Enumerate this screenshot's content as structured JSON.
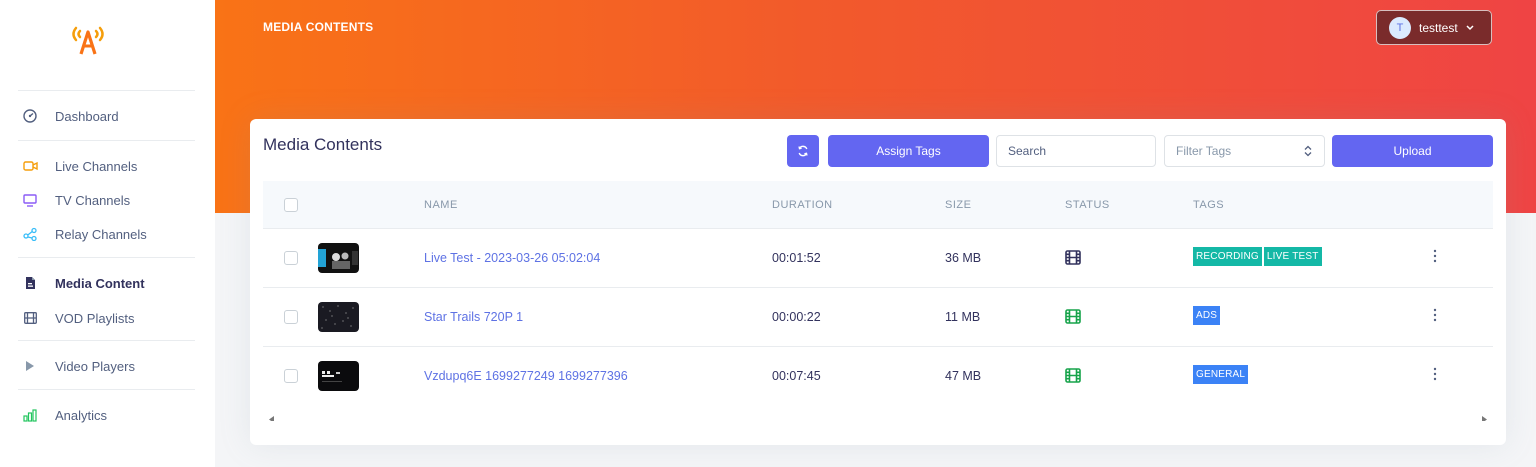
{
  "sidebar": {
    "items": [
      {
        "label": "Dashboard",
        "icon": "gauge-icon"
      },
      {
        "label": "Live Channels",
        "icon": "video-camera-icon"
      },
      {
        "label": "TV Channels",
        "icon": "tv-icon"
      },
      {
        "label": "Relay Channels",
        "icon": "share-nodes-icon"
      },
      {
        "label": "Media Content",
        "icon": "file-icon"
      },
      {
        "label": "VOD Playlists",
        "icon": "film-icon"
      },
      {
        "label": "Video Players",
        "icon": "play-icon"
      },
      {
        "label": "Analytics",
        "icon": "bar-chart-icon"
      }
    ],
    "active": "Media Content"
  },
  "header": {
    "title": "MEDIA CONTENTS",
    "user": {
      "initial": "T",
      "name": "testtest"
    }
  },
  "card": {
    "title": "Media Contents",
    "assign_tags_label": "Assign Tags",
    "search_placeholder": "Search",
    "filter_placeholder": "Filter Tags",
    "upload_label": "Upload"
  },
  "table": {
    "columns": {
      "name": "NAME",
      "duration": "DURATION",
      "size": "SIZE",
      "status": "STATUS",
      "tags": "TAGS"
    },
    "rows": [
      {
        "name": "Live Test - 2023-03-26 05:02:04",
        "duration": "00:01:52",
        "size": "36 MB",
        "status_color": "#32325d",
        "tags": [
          "RECORDING",
          "LIVE TEST"
        ]
      },
      {
        "name": "Star Trails 720P 1",
        "duration": "00:00:22",
        "size": "11 MB",
        "status_color": "#16a34a",
        "tags": [
          "ADS"
        ]
      },
      {
        "name": "Vzdupq6E 1699277249 1699277396",
        "duration": "00:07:45",
        "size": "47 MB",
        "status_color": "#16a34a",
        "tags": [
          "GENERAL"
        ]
      }
    ]
  },
  "colors": {
    "accent": "#6366f1",
    "link": "#5e72e4",
    "tag_teal": "#14b8a6",
    "tag_blue": "#3b82f6",
    "header_start": "#f97316",
    "header_end": "#ef4444"
  }
}
